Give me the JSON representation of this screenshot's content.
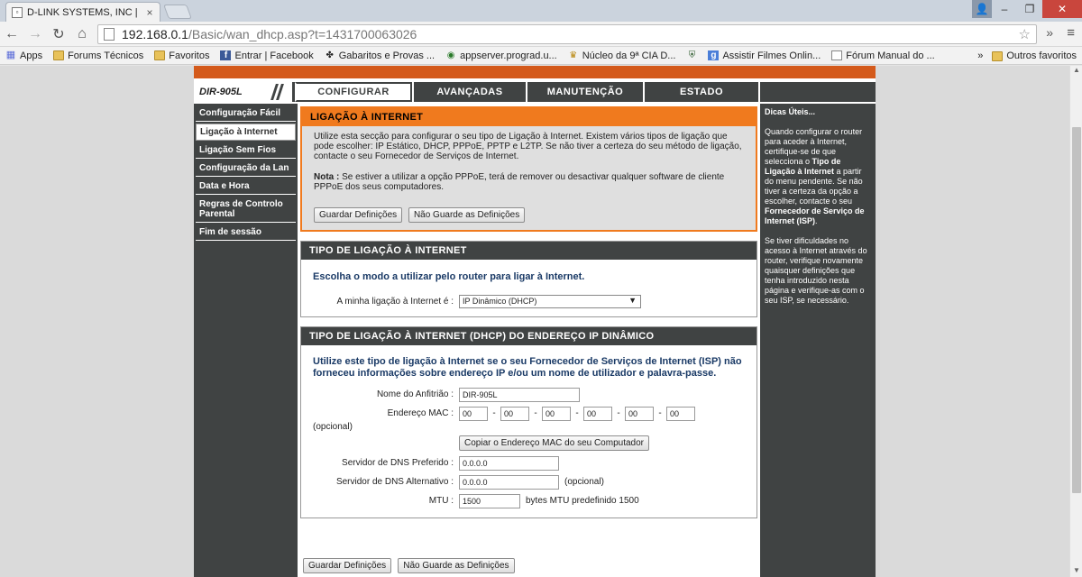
{
  "browser": {
    "tab_title": "D-LINK SYSTEMS, INC | RO",
    "url_host": "192.168.0.1",
    "url_path": "/Basic/wan_dhcp.asp?t=1431700063026",
    "bookmarks": [
      {
        "icon": "apps",
        "label": "Apps"
      },
      {
        "icon": "folder",
        "label": "Forums Técnicos"
      },
      {
        "icon": "folder",
        "label": "Favoritos"
      },
      {
        "icon": "fb",
        "label": "Entrar | Facebook"
      },
      {
        "icon": "puzzle",
        "label": "Gabaritos e Provas ..."
      },
      {
        "icon": "doc",
        "label": "appserver.prograd.u..."
      },
      {
        "icon": "badge",
        "label": "Núcleo da 9ª CIA D..."
      },
      {
        "icon": "shield",
        "label": ""
      },
      {
        "icon": "g",
        "label": "Assistir Filmes Onlin..."
      },
      {
        "icon": "doc",
        "label": "Fórum Manual do ..."
      }
    ],
    "overflow": "»",
    "other_bookmarks": "Outros favoritos"
  },
  "router": {
    "model": "DIR-905L",
    "tabs": [
      "CONFIGURAR",
      "AVANÇADAS",
      "MANUTENÇÃO",
      "ESTADO"
    ],
    "left_nav": [
      "Configuração Fácil",
      "Ligação à Internet",
      "Ligação Sem Fios",
      "Configuração da Lan",
      "Data e Hora",
      "Regras de Controlo Parental",
      "Fim de sessão"
    ],
    "section1": {
      "title": "LIGAÇÃO À INTERNET",
      "text": "Utilize esta secção para configurar o seu tipo de Ligação à Internet. Existem vários tipos de ligação que pode escolher: IP Estático, DHCP, PPPoE, PPTP e L2TP. Se não tiver a certeza do seu método de ligação, contacte o seu Fornecedor de Serviços de Internet.",
      "note_label": "Nota :",
      "note_text": " Se estiver a utilizar a opção PPPoE, terá de remover ou desactivar qualquer software de cliente PPPoE dos seus computadores.",
      "save": "Guardar Definições",
      "dont_save": "Não Guarde as Definições"
    },
    "section2": {
      "title": "TIPO DE LIGAÇÃO À INTERNET",
      "intro": "Escolha o modo a utilizar pelo router para ligar à Internet.",
      "label": "A minha ligação à Internet é :",
      "value": "IP Dinâmico (DHCP)"
    },
    "section3": {
      "title": "TIPO DE LIGAÇÃO À INTERNET (DHCP) DO ENDEREÇO IP DINÂMICO",
      "intro": "Utilize este tipo de ligação à Internet se o seu Fornecedor de Serviços de Internet (ISP) não forneceu informações sobre endereço IP e/ou um nome de utilizador e palavra-passe.",
      "host_label": "Nome do Anfitrião :",
      "host_value": "DIR-905L",
      "mac_label": "Endereço MAC :",
      "mac_values": [
        "00",
        "00",
        "00",
        "00",
        "00",
        "00"
      ],
      "mac_sep": "-",
      "optional": "(opcional)",
      "copy_mac": "Copiar o Endereço MAC do seu Computador",
      "dns1_label": "Servidor de DNS Preferido :",
      "dns1_value": "0.0.0.0",
      "dns2_label": "Servidor de DNS Alternativo :",
      "dns2_value": "0.0.0.0",
      "mtu_label": "MTU :",
      "mtu_value": "1500",
      "mtu_note": "bytes MTU predefinido 1500"
    },
    "bottom": {
      "save": "Guardar Definições",
      "dont_save": "Não Guarde as Definições"
    },
    "hints": {
      "title": "Dicas Úteis...",
      "p1_a": "Quando configurar o router para aceder à Internet, certifique-se de que selecciona o ",
      "p1_b": "Tipo de Ligação à Internet",
      "p1_c": " a partir do menu pendente. Se não tiver a certeza da opção a escolher, contacte o seu ",
      "p1_d": "Fornecedor de Serviço de Internet",
      "p1_e": " ",
      "p1_f": "(ISP)",
      "p1_g": ".",
      "p2": "Se tiver dificuldades no acesso à Internet através do router, verifique novamente quaisquer definições que tenha introduzido nesta página e verifique-as com o seu ISP, se necessário."
    }
  }
}
